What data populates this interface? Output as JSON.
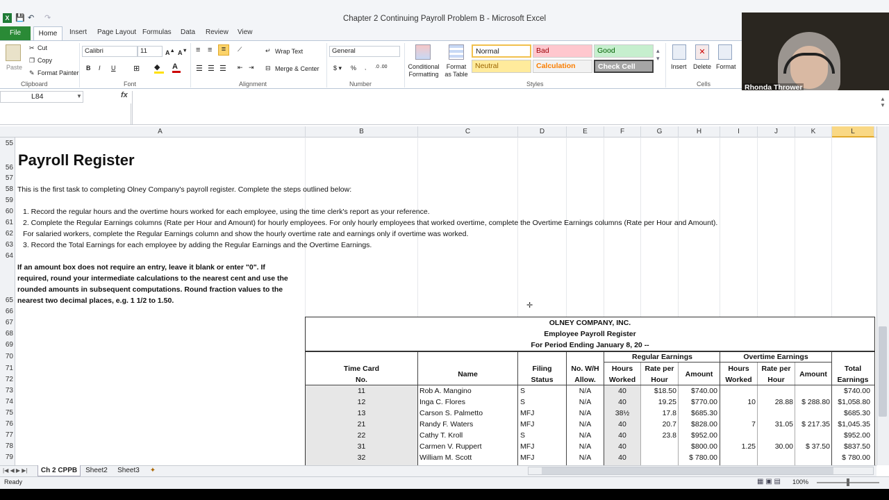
{
  "window": {
    "title": "Chapter 2 Continuing Payroll Problem  B  -  Microsoft Excel"
  },
  "tabs": [
    "File",
    "Home",
    "Insert",
    "Page Layout",
    "Formulas",
    "Data",
    "Review",
    "View"
  ],
  "ribbon": {
    "paste": "Paste",
    "cut": "Cut",
    "copy": "Copy",
    "format_painter": "Format Painter",
    "clipboard": "Clipboard",
    "font_name": "Calibri",
    "font_size": "11",
    "font": "Font",
    "wrap_text": "Wrap Text",
    "merge_center": "Merge & Center",
    "alignment": "Alignment",
    "number_format": "General",
    "number": "Number",
    "cond_format": "Conditional Formatting",
    "format_table": "Format as Table",
    "styles": "Styles",
    "style_normal": "Normal",
    "style_bad": "Bad",
    "style_good": "Good",
    "style_neutral": "Neutral",
    "style_calc": "Calculation",
    "style_check": "Check Cell",
    "insert": "Insert",
    "delete": "Delete",
    "format": "Format",
    "cells": "Cells"
  },
  "webcam": {
    "name": "Rhonda Thrower"
  },
  "formula_bar": {
    "name_box": "L84",
    "fx": "fx",
    "value": ""
  },
  "columns": [
    "A",
    "B",
    "C",
    "D",
    "E",
    "F",
    "G",
    "H",
    "I",
    "J",
    "K",
    "L"
  ],
  "rows": [
    "55",
    "56",
    "57",
    "58",
    "59",
    "60",
    "61",
    "62",
    "63",
    "64",
    "65",
    "66",
    "67",
    "68",
    "69",
    "70",
    "71",
    "72",
    "73",
    "74",
    "75",
    "76",
    "77",
    "78",
    "79"
  ],
  "sheet": {
    "title": "Payroll Register",
    "intro": "This is the first task to completing Olney Company's payroll register. Complete the steps outlined below:",
    "step1": "1. Record the regular hours and the overtime hours worked for each employee, using the time clerk's report as your reference.",
    "step2": "2. Complete the Regular Earnings columns (Rate per Hour and Amount) for hourly employees. For only hourly employees that worked overtime, complete the Overtime Earnings columns (Rate per Hour and Amount).",
    "step2b": "For salaried workers, complete the Regular Earnings column and show the hourly overtime rate and earnings only if overtime was worked.",
    "step3": "3. Record the Total Earnings for each employee by adding the Regular Earnings and the Overtime Earnings.",
    "note1": "If an amount box does not require an entry, leave it blank or enter \"0\". If",
    "note2": "required, round your intermediate calculations to the nearest cent and use the",
    "note3": "rounded amounts in subsequent computations. Round fraction values to the",
    "note4": "nearest two decimal places, e.g. 1 1/2 to 1.50."
  },
  "register": {
    "company": "OLNEY COMPANY, INC.",
    "title": "Employee Payroll Register",
    "period": "For Period Ending January 8, 20 --",
    "regular_earnings": "Regular Earnings",
    "overtime_earnings": "Overtime Earnings",
    "h_timecard1": "Time Card",
    "h_timecard2": "No.",
    "h_name": "Name",
    "h_filing1": "Filing",
    "h_filing2": "Status",
    "h_wh1": "No. W/H",
    "h_wh2": "Allow.",
    "h_hours1": "Hours",
    "h_hours2": "Worked",
    "h_rate1": "Rate per",
    "h_rate2": "Hour",
    "h_amount": "Amount",
    "h_othours1": "Hours",
    "h_othours2": "Worked",
    "h_otrate1": "Rate per",
    "h_otrate2": "Hour",
    "h_otamount": "Amount",
    "h_total1": "Total",
    "h_total2": "Earnings",
    "rows": [
      {
        "card": "11",
        "name": "Rob A. Mangino",
        "status": "S",
        "wh": "N/A",
        "hours": "40",
        "rate": "$18.50",
        "amount": "$740.00",
        "othours": "",
        "otrate": "",
        "otamount": "",
        "total": "$740.00"
      },
      {
        "card": "12",
        "name": "Inga C. Flores",
        "status": "S",
        "wh": "N/A",
        "hours": "40",
        "rate": "19.25",
        "amount": "$770.00",
        "othours": "10",
        "otrate": "28.88",
        "otamount": "$ 288.80",
        "total": "$1,058.80"
      },
      {
        "card": "13",
        "name": "Carson S. Palmetto",
        "status": "MFJ",
        "wh": "N/A",
        "hours": "38½",
        "rate": "17.8",
        "amount": "$685.30",
        "othours": "",
        "otrate": "",
        "otamount": "",
        "total": "$685.30"
      },
      {
        "card": "21",
        "name": "Randy F. Waters",
        "status": "MFJ",
        "wh": "N/A",
        "hours": "40",
        "rate": "20.7",
        "amount": "$828.00",
        "othours": "7",
        "otrate": "31.05",
        "otamount": "$ 217.35",
        "total": "$1,045.35"
      },
      {
        "card": "22",
        "name": "Cathy T. Kroll",
        "status": "S",
        "wh": "N/A",
        "hours": "40",
        "rate": "23.8",
        "amount": "$952.00",
        "othours": "",
        "otrate": "",
        "otamount": "",
        "total": "$952.00"
      },
      {
        "card": "31",
        "name": "Carmen V. Ruppert",
        "status": "MFJ",
        "wh": "N/A",
        "hours": "40",
        "rate": "",
        "amount": "$800.00",
        "othours": "1.25",
        "otrate": "30.00",
        "otamount": "$  37.50",
        "total": "$837.50"
      },
      {
        "card": "32",
        "name": "William M. Scott",
        "status": "MFJ",
        "wh": "N/A",
        "hours": "40",
        "rate": "",
        "amount": "$   780.00",
        "othours": "",
        "otrate": "",
        "otamount": "",
        "total": "$   780.00"
      }
    ]
  },
  "sheet_tabs": [
    "Ch 2 CPPB",
    "Sheet2",
    "Sheet3"
  ],
  "status": {
    "ready": "Ready",
    "zoom": "100%"
  }
}
